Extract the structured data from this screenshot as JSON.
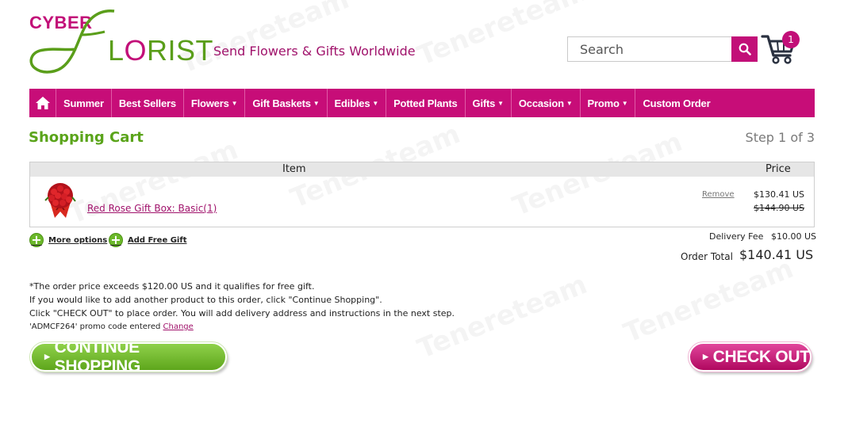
{
  "brand": {
    "logo_top": "CYBER",
    "logo_bottom_pre": "L",
    "logo_bottom_o": "O",
    "logo_bottom_post": "RIST",
    "tagline": "Send Flowers & Gifts Worldwide",
    "primary_color": "#c70d78",
    "green_color": "#5aa41a"
  },
  "search": {
    "placeholder": "Search"
  },
  "cart": {
    "count": "1"
  },
  "nav": {
    "items": [
      {
        "label": "Summer",
        "dropdown": false
      },
      {
        "label": "Best Sellers",
        "dropdown": false
      },
      {
        "label": "Flowers",
        "dropdown": true
      },
      {
        "label": "Gift Baskets",
        "dropdown": true
      },
      {
        "label": "Edibles",
        "dropdown": true
      },
      {
        "label": "Potted Plants",
        "dropdown": false
      },
      {
        "label": "Gifts",
        "dropdown": true
      },
      {
        "label": "Occasion",
        "dropdown": true
      },
      {
        "label": "Promo",
        "dropdown": true
      },
      {
        "label": "Custom Order",
        "dropdown": false
      }
    ]
  },
  "page": {
    "title": "Shopping Cart",
    "step": "Step 1 of 3"
  },
  "table": {
    "headers": {
      "item": "Item",
      "price": "Price"
    },
    "row": {
      "product_name": "Red Rose Gift Box: Basic(1)",
      "remove_label": "Remove",
      "price": "$130.41 US",
      "original_price": "$144.90 US"
    }
  },
  "options": {
    "more": "More options",
    "gift": "Add Free Gift"
  },
  "summary": {
    "fee_label": "Delivery Fee",
    "fee_value": "$10.00 US",
    "total_label": "Order Total",
    "total_value": "$140.41 US"
  },
  "notes": {
    "line1": "*The order price exceeds $120.00 US and it qualifies for free gift.",
    "line2": "If you would like to add another product to this order, click \"Continue Shopping\".",
    "line3": "Click \"CHECK OUT\" to place order. You will add delivery address and instructions in the next step.",
    "promo": "'ADMCF264' promo code entered",
    "change_label": "Change"
  },
  "buttons": {
    "continue": "CONTINUE SHOPPING",
    "checkout": "CHECK OUT"
  },
  "watermark": "Tenereteam"
}
